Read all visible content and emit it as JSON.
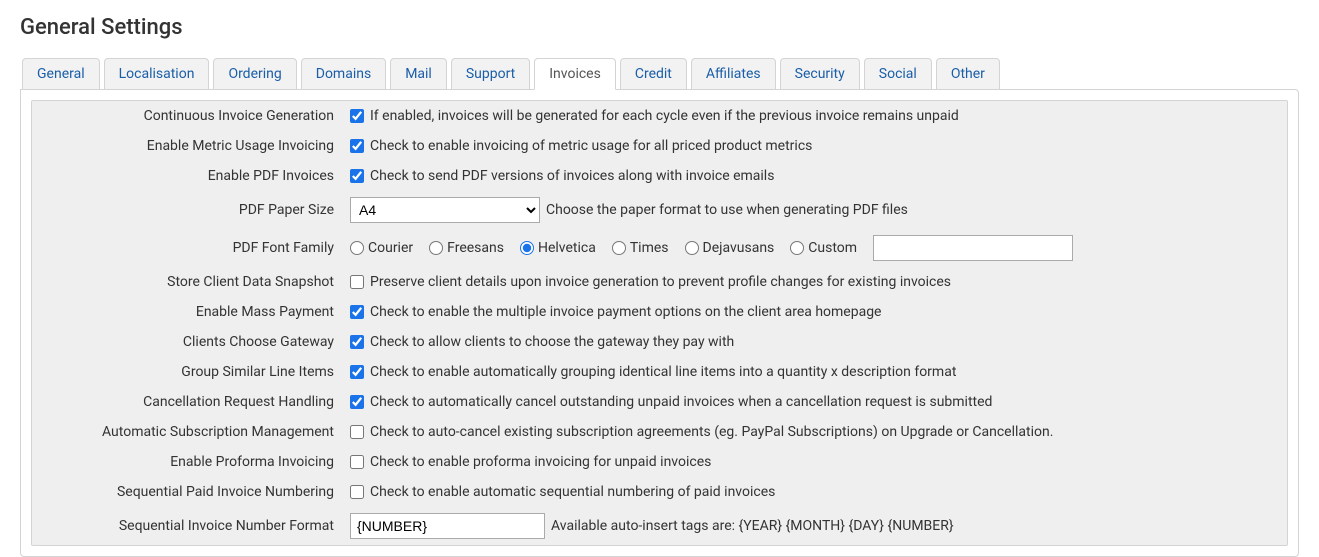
{
  "title": "General Settings",
  "tabs": {
    "general": "General",
    "localisation": "Localisation",
    "ordering": "Ordering",
    "domains": "Domains",
    "mail": "Mail",
    "support": "Support",
    "invoices": "Invoices",
    "credit": "Credit",
    "affiliates": "Affiliates",
    "security": "Security",
    "social": "Social",
    "other": "Other"
  },
  "rows": {
    "continuous": {
      "label": "Continuous Invoice Generation",
      "desc": "If enabled, invoices will be generated for each cycle even if the previous invoice remains unpaid",
      "checked": true
    },
    "metric": {
      "label": "Enable Metric Usage Invoicing",
      "desc": "Check to enable invoicing of metric usage for all priced product metrics",
      "checked": true
    },
    "pdf": {
      "label": "Enable PDF Invoices",
      "desc": "Check to send PDF versions of invoices along with invoice emails",
      "checked": true
    },
    "papersize": {
      "label": "PDF Paper Size",
      "value": "A4",
      "desc": "Choose the paper format to use when generating PDF files"
    },
    "font": {
      "label": "PDF Font Family",
      "options": {
        "courier": "Courier",
        "freesans": "Freesans",
        "helvetica": "Helvetica",
        "times": "Times",
        "dejavusans": "Dejavusans",
        "custom": "Custom"
      },
      "selected": "helvetica",
      "custom_value": ""
    },
    "snapshot": {
      "label": "Store Client Data Snapshot",
      "desc": "Preserve client details upon invoice generation to prevent profile changes for existing invoices",
      "checked": false
    },
    "mass": {
      "label": "Enable Mass Payment",
      "desc": "Check to enable the multiple invoice payment options on the client area homepage",
      "checked": true
    },
    "gateway": {
      "label": "Clients Choose Gateway",
      "desc": "Check to allow clients to choose the gateway they pay with",
      "checked": true
    },
    "group": {
      "label": "Group Similar Line Items",
      "desc": "Check to enable automatically grouping identical line items into a quantity x description format",
      "checked": true
    },
    "cancel": {
      "label": "Cancellation Request Handling",
      "desc": "Check to automatically cancel outstanding unpaid invoices when a cancellation request is submitted",
      "checked": true
    },
    "subscription": {
      "label": "Automatic Subscription Management",
      "desc": "Check to auto-cancel existing subscription agreements (eg. PayPal Subscriptions) on Upgrade or Cancellation.",
      "checked": false
    },
    "proforma": {
      "label": "Enable Proforma Invoicing",
      "desc": "Check to enable proforma invoicing for unpaid invoices",
      "checked": false
    },
    "sequential": {
      "label": "Sequential Paid Invoice Numbering",
      "desc": "Check to enable automatic sequential numbering of paid invoices",
      "checked": false
    },
    "format": {
      "label": "Sequential Invoice Number Format",
      "value": "{NUMBER}",
      "desc": "Available auto-insert tags are: {YEAR} {MONTH} {DAY} {NUMBER}"
    }
  }
}
